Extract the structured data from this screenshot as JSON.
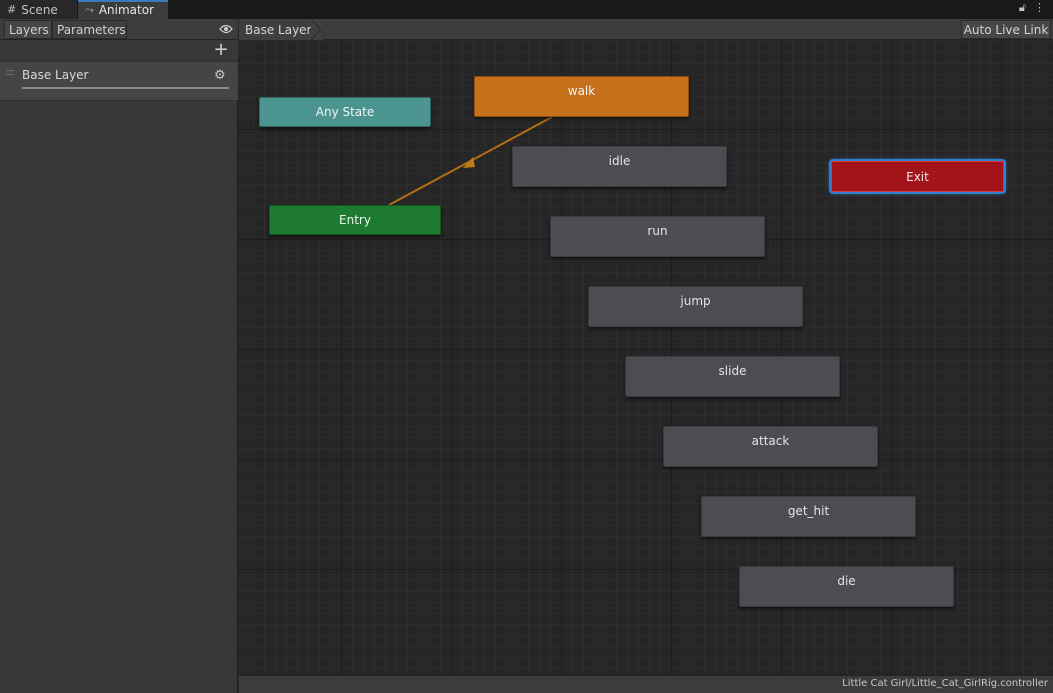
{
  "tabs": [
    {
      "label": "Scene",
      "icon": "grid-icon",
      "active": false
    },
    {
      "label": "Animator",
      "icon": "animator-icon",
      "active": true
    }
  ],
  "window_controls": {
    "lock_icon": "lock-icon",
    "menu_icon": "kebab-menu-icon"
  },
  "left_panel": {
    "tab_layers": "Layers",
    "tab_parameters": "Parameters",
    "eye_icon": "eye-icon",
    "add_icon": "plus-icon",
    "layers": [
      {
        "name": "Base Layer",
        "weight": 1.0
      }
    ]
  },
  "graph": {
    "breadcrumb": "Base Layer",
    "auto_live_link": "Auto Live Link",
    "states": {
      "walk": "walk",
      "idle": "idle",
      "run": "run",
      "jump": "jump",
      "slide": "slide",
      "attack": "attack",
      "get_hit": "get_hit",
      "die": "die"
    },
    "any_state": "Any State",
    "entry": "Entry",
    "exit": "Exit",
    "default_transition": {
      "from": "Entry",
      "to": "walk"
    }
  },
  "status_bar": {
    "path": "Little Cat Girl/Little_Cat_GirlRig.controller"
  },
  "colors": {
    "default_state": "#c6701b",
    "any_state": "#4c9490",
    "entry": "#1e7a31",
    "exit": "#a3141a",
    "state": "#4c4d52",
    "transition": "#c67a16",
    "selection": "#2f7fd2"
  }
}
